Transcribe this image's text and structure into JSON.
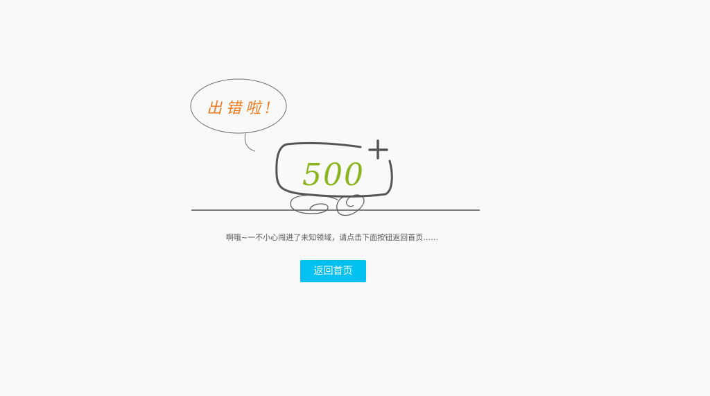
{
  "illustration": {
    "bubble_text": "出错啦!",
    "error_code": "500",
    "plus_sign": "+"
  },
  "message": "啊哦~一不小心闯进了未知领域，请点击下面按钮返回首页……",
  "home_button": {
    "label": "返回首页"
  },
  "colors": {
    "background": "#f9f9f9",
    "bubble_text": "#f07b1e",
    "error_code": "#8ab51f",
    "button": "#00c1f1",
    "outline": "#555555"
  }
}
